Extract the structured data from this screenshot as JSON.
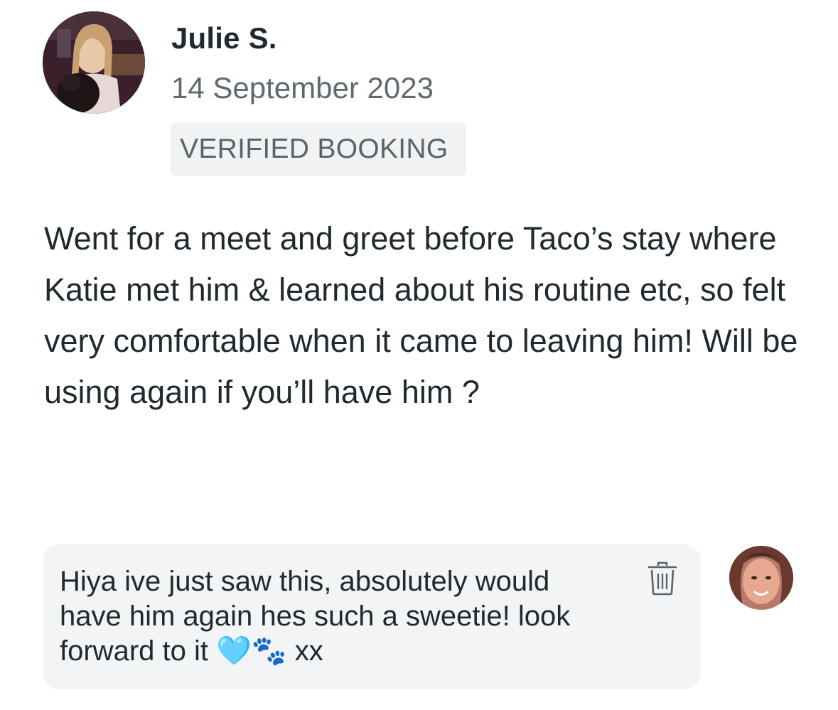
{
  "review": {
    "reviewer_name": "Julie S.",
    "date": "14 September 2023",
    "badge": "VERIFIED BOOKING",
    "text": "Went for a meet and greet before Taco’s stay where Katie met him & learned about his routine etc, so felt very comfortable when it came to leaving him! Will be using again if you’ll have him ?"
  },
  "reply": {
    "text": "Hiya ive just saw this, absolutely would have him again hes such a sweetie! look forward to it 🩵🐾 xx",
    "delete_icon": "trash-icon"
  },
  "avatars": {
    "reviewer": "reviewer-photo",
    "responder": "responder-photo"
  }
}
